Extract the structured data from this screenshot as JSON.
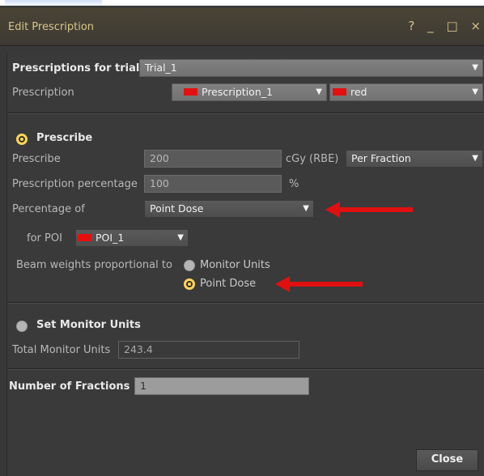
{
  "window": {
    "title": "Edit Prescription",
    "controls": {
      "help": "?",
      "minimize": "_",
      "maximize": "□",
      "close": "×"
    }
  },
  "trial": {
    "label": "Prescriptions for trial",
    "value": "Trial_1"
  },
  "prescription": {
    "label": "Prescription",
    "name": "Prescription_1",
    "color_name": "red",
    "swatch_color": "#e41010"
  },
  "prescribe_section": {
    "radio_label": "Prescribe",
    "selected": true,
    "prescribe_label": "Prescribe",
    "prescribe_value": "200",
    "unit": "cGy (RBE)",
    "per": "Per Fraction",
    "percentage_label": "Prescription percentage",
    "percentage_value": "100",
    "percent_sign": "%",
    "percentage_of_label": "Percentage of",
    "percentage_of_value": "Point Dose",
    "poi_label": "for POI",
    "poi_value": "POI_1",
    "beam_weights_label": "Beam weights proportional to",
    "options": [
      {
        "label": "Monitor Units",
        "selected": false
      },
      {
        "label": "Point Dose",
        "selected": true
      }
    ]
  },
  "monitor_units_section": {
    "radio_label": "Set Monitor Units",
    "selected": false,
    "total_label": "Total Monitor Units",
    "total_value": "243.4"
  },
  "fractions": {
    "label": "Number of Fractions",
    "value": "1"
  },
  "close_label": "Close",
  "accent_color": "#ffd35a",
  "annotation_arrow_color": "#e01010"
}
